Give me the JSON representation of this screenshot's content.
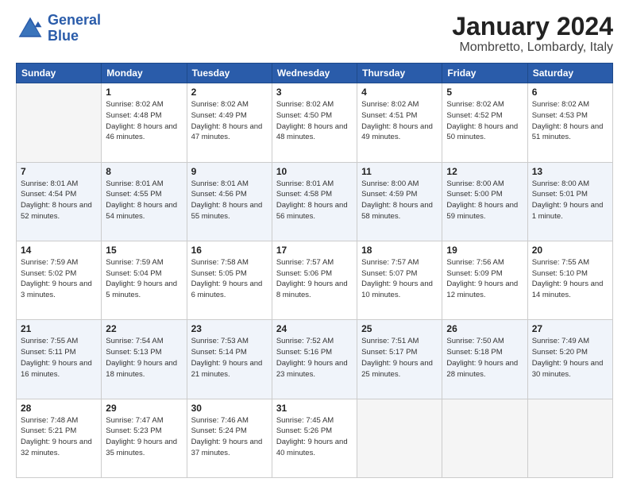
{
  "header": {
    "logo_line1": "General",
    "logo_line2": "Blue",
    "month": "January 2024",
    "location": "Mombretto, Lombardy, Italy"
  },
  "weekdays": [
    "Sunday",
    "Monday",
    "Tuesday",
    "Wednesday",
    "Thursday",
    "Friday",
    "Saturday"
  ],
  "weeks": [
    [
      {
        "day": "",
        "empty": true
      },
      {
        "day": "1",
        "sunrise": "Sunrise: 8:02 AM",
        "sunset": "Sunset: 4:48 PM",
        "daylight": "Daylight: 8 hours and 46 minutes."
      },
      {
        "day": "2",
        "sunrise": "Sunrise: 8:02 AM",
        "sunset": "Sunset: 4:49 PM",
        "daylight": "Daylight: 8 hours and 47 minutes."
      },
      {
        "day": "3",
        "sunrise": "Sunrise: 8:02 AM",
        "sunset": "Sunset: 4:50 PM",
        "daylight": "Daylight: 8 hours and 48 minutes."
      },
      {
        "day": "4",
        "sunrise": "Sunrise: 8:02 AM",
        "sunset": "Sunset: 4:51 PM",
        "daylight": "Daylight: 8 hours and 49 minutes."
      },
      {
        "day": "5",
        "sunrise": "Sunrise: 8:02 AM",
        "sunset": "Sunset: 4:52 PM",
        "daylight": "Daylight: 8 hours and 50 minutes."
      },
      {
        "day": "6",
        "sunrise": "Sunrise: 8:02 AM",
        "sunset": "Sunset: 4:53 PM",
        "daylight": "Daylight: 8 hours and 51 minutes."
      }
    ],
    [
      {
        "day": "7",
        "sunrise": "Sunrise: 8:01 AM",
        "sunset": "Sunset: 4:54 PM",
        "daylight": "Daylight: 8 hours and 52 minutes."
      },
      {
        "day": "8",
        "sunrise": "Sunrise: 8:01 AM",
        "sunset": "Sunset: 4:55 PM",
        "daylight": "Daylight: 8 hours and 54 minutes."
      },
      {
        "day": "9",
        "sunrise": "Sunrise: 8:01 AM",
        "sunset": "Sunset: 4:56 PM",
        "daylight": "Daylight: 8 hours and 55 minutes."
      },
      {
        "day": "10",
        "sunrise": "Sunrise: 8:01 AM",
        "sunset": "Sunset: 4:58 PM",
        "daylight": "Daylight: 8 hours and 56 minutes."
      },
      {
        "day": "11",
        "sunrise": "Sunrise: 8:00 AM",
        "sunset": "Sunset: 4:59 PM",
        "daylight": "Daylight: 8 hours and 58 minutes."
      },
      {
        "day": "12",
        "sunrise": "Sunrise: 8:00 AM",
        "sunset": "Sunset: 5:00 PM",
        "daylight": "Daylight: 8 hours and 59 minutes."
      },
      {
        "day": "13",
        "sunrise": "Sunrise: 8:00 AM",
        "sunset": "Sunset: 5:01 PM",
        "daylight": "Daylight: 9 hours and 1 minute."
      }
    ],
    [
      {
        "day": "14",
        "sunrise": "Sunrise: 7:59 AM",
        "sunset": "Sunset: 5:02 PM",
        "daylight": "Daylight: 9 hours and 3 minutes."
      },
      {
        "day": "15",
        "sunrise": "Sunrise: 7:59 AM",
        "sunset": "Sunset: 5:04 PM",
        "daylight": "Daylight: 9 hours and 5 minutes."
      },
      {
        "day": "16",
        "sunrise": "Sunrise: 7:58 AM",
        "sunset": "Sunset: 5:05 PM",
        "daylight": "Daylight: 9 hours and 6 minutes."
      },
      {
        "day": "17",
        "sunrise": "Sunrise: 7:57 AM",
        "sunset": "Sunset: 5:06 PM",
        "daylight": "Daylight: 9 hours and 8 minutes."
      },
      {
        "day": "18",
        "sunrise": "Sunrise: 7:57 AM",
        "sunset": "Sunset: 5:07 PM",
        "daylight": "Daylight: 9 hours and 10 minutes."
      },
      {
        "day": "19",
        "sunrise": "Sunrise: 7:56 AM",
        "sunset": "Sunset: 5:09 PM",
        "daylight": "Daylight: 9 hours and 12 minutes."
      },
      {
        "day": "20",
        "sunrise": "Sunrise: 7:55 AM",
        "sunset": "Sunset: 5:10 PM",
        "daylight": "Daylight: 9 hours and 14 minutes."
      }
    ],
    [
      {
        "day": "21",
        "sunrise": "Sunrise: 7:55 AM",
        "sunset": "Sunset: 5:11 PM",
        "daylight": "Daylight: 9 hours and 16 minutes."
      },
      {
        "day": "22",
        "sunrise": "Sunrise: 7:54 AM",
        "sunset": "Sunset: 5:13 PM",
        "daylight": "Daylight: 9 hours and 18 minutes."
      },
      {
        "day": "23",
        "sunrise": "Sunrise: 7:53 AM",
        "sunset": "Sunset: 5:14 PM",
        "daylight": "Daylight: 9 hours and 21 minutes."
      },
      {
        "day": "24",
        "sunrise": "Sunrise: 7:52 AM",
        "sunset": "Sunset: 5:16 PM",
        "daylight": "Daylight: 9 hours and 23 minutes."
      },
      {
        "day": "25",
        "sunrise": "Sunrise: 7:51 AM",
        "sunset": "Sunset: 5:17 PM",
        "daylight": "Daylight: 9 hours and 25 minutes."
      },
      {
        "day": "26",
        "sunrise": "Sunrise: 7:50 AM",
        "sunset": "Sunset: 5:18 PM",
        "daylight": "Daylight: 9 hours and 28 minutes."
      },
      {
        "day": "27",
        "sunrise": "Sunrise: 7:49 AM",
        "sunset": "Sunset: 5:20 PM",
        "daylight": "Daylight: 9 hours and 30 minutes."
      }
    ],
    [
      {
        "day": "28",
        "sunrise": "Sunrise: 7:48 AM",
        "sunset": "Sunset: 5:21 PM",
        "daylight": "Daylight: 9 hours and 32 minutes."
      },
      {
        "day": "29",
        "sunrise": "Sunrise: 7:47 AM",
        "sunset": "Sunset: 5:23 PM",
        "daylight": "Daylight: 9 hours and 35 minutes."
      },
      {
        "day": "30",
        "sunrise": "Sunrise: 7:46 AM",
        "sunset": "Sunset: 5:24 PM",
        "daylight": "Daylight: 9 hours and 37 minutes."
      },
      {
        "day": "31",
        "sunrise": "Sunrise: 7:45 AM",
        "sunset": "Sunset: 5:26 PM",
        "daylight": "Daylight: 9 hours and 40 minutes."
      },
      {
        "day": "",
        "empty": true
      },
      {
        "day": "",
        "empty": true
      },
      {
        "day": "",
        "empty": true
      }
    ]
  ]
}
